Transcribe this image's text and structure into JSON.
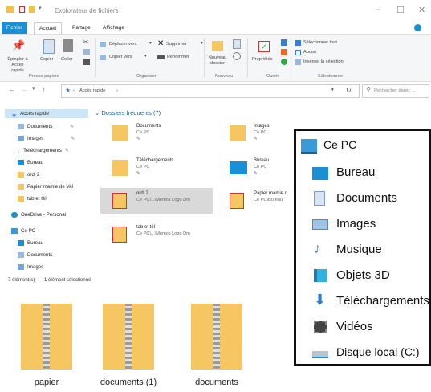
{
  "window": {
    "title": "Explorateur de fichiers",
    "controls": [
      "–",
      "☐",
      "✕"
    ]
  },
  "tabs": [
    "Fichier",
    "Accueil",
    "Partage",
    "Affichage"
  ],
  "ribbon": {
    "presse_papiers": {
      "group": "Presse-papiers",
      "pin": "Épingler à Accès rapide",
      "copy": "Copier",
      "paste": "Coller"
    },
    "organiser": {
      "group": "Organiser",
      "move": "Déplacer vers",
      "copy_to": "Copier vers",
      "delete": "Supprimer",
      "rename": "Renommer"
    },
    "nouveau": {
      "group": "Nouveau",
      "new_folder": "Nouveau dossier"
    },
    "ouvrir": {
      "group": "Ouvrir",
      "properties": "Propriétés"
    },
    "selectionner": {
      "group": "Sélectionner",
      "select_all": "Sélectionner tout",
      "none": "Aucun",
      "invert": "Inverser la sélection"
    }
  },
  "address": {
    "path": "Accès rapide",
    "search_placeholder": "Rechercher dans : ..."
  },
  "nav": {
    "items": [
      {
        "label": "Accès rapide"
      },
      {
        "label": "Documents"
      },
      {
        "label": "Images"
      },
      {
        "label": "Téléchargements"
      },
      {
        "label": "Bureau"
      },
      {
        "label": "ordi 2"
      },
      {
        "label": "Papier mamie de Val"
      },
      {
        "label": "tab et tél"
      },
      {
        "label": "OneDrive - Personal"
      },
      {
        "label": "Ce PC"
      },
      {
        "label": "Bureau"
      },
      {
        "label": "Documents"
      },
      {
        "label": "Images"
      }
    ]
  },
  "content": {
    "section": "Dossiers fréquents (7)",
    "items": [
      {
        "name": "Documents",
        "sub": "Ce PC"
      },
      {
        "name": "Images",
        "sub": "Ce PC"
      },
      {
        "name": "Téléchargements",
        "sub": "Ce PC"
      },
      {
        "name": "Bureau",
        "sub": "Ce PC"
      },
      {
        "name": "ordi 2",
        "sub": "Ce PC\\...\\Mémos Logo Dm"
      },
      {
        "name": "Papier mamie d",
        "sub": "Ce PC\\Bureau"
      },
      {
        "name": "tab et tél",
        "sub": "Ce PC\\...\\Mémos Logo Dm"
      }
    ]
  },
  "status": {
    "count": "7 élément(s)",
    "selected": "1 élément sélectionné"
  },
  "panel": {
    "title": "Ce PC",
    "items": [
      "Bureau",
      "Documents",
      "Images",
      "Musique",
      "Objets 3D",
      "Téléchargements",
      "Vidéos",
      "Disque local (C:)"
    ]
  },
  "bottom_folders": [
    "papier",
    "documents (1)",
    "documents"
  ],
  "colors": {
    "accent": "#1a8fd6",
    "folder": "#f5c662",
    "selection": "#cce6f7"
  }
}
